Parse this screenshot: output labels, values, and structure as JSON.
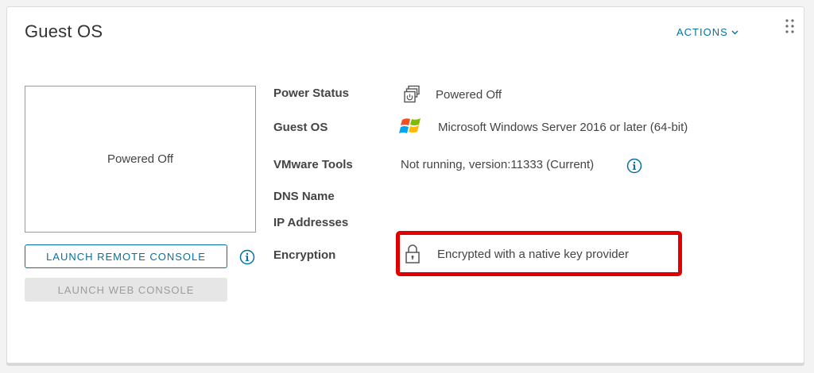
{
  "card": {
    "title": "Guest OS",
    "actions_label": "ACTIONS"
  },
  "console": {
    "preview_text": "Powered Off",
    "launch_remote_label": "LAUNCH REMOTE CONSOLE",
    "launch_web_label": "LAUNCH WEB CONSOLE"
  },
  "details": {
    "power_status": {
      "label": "Power Status",
      "value": "Powered Off",
      "icon": "vm-power-icon"
    },
    "guest_os": {
      "label": "Guest OS",
      "value": "Microsoft Windows Server 2016 or later (64-bit)",
      "icon": "windows-logo-icon"
    },
    "vmware_tools": {
      "label": "VMware Tools",
      "value": "Not running, version:11333 (Current)"
    },
    "dns_name": {
      "label": "DNS Name",
      "value": ""
    },
    "ip_addresses": {
      "label": "IP Addresses",
      "value": ""
    },
    "encryption": {
      "label": "Encryption",
      "value": "Encrypted with a native key provider",
      "icon": "lock-icon"
    }
  },
  "colors": {
    "accent": "#0072a3",
    "highlight": "#e00000",
    "disabled_bg": "#e6e6e6"
  }
}
